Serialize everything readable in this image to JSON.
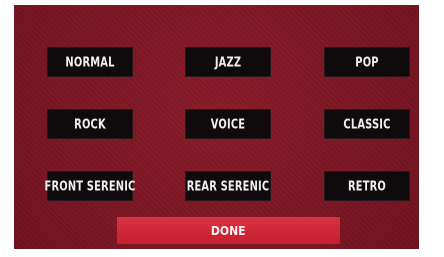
{
  "presets": [
    {
      "label": "NORMAL"
    },
    {
      "label": "JAZZ"
    },
    {
      "label": "POP"
    },
    {
      "label": "ROCK"
    },
    {
      "label": "VOICE"
    },
    {
      "label": "CLASSIC"
    },
    {
      "label": "FRONT SERENIC"
    },
    {
      "label": "REAR SERENIC"
    },
    {
      "label": "RETRO"
    }
  ],
  "done_label": "DONE",
  "colors": {
    "panel_bg": "#7b1722",
    "button_bg": "#0f0a0b",
    "done_bg": "#cd2838"
  }
}
